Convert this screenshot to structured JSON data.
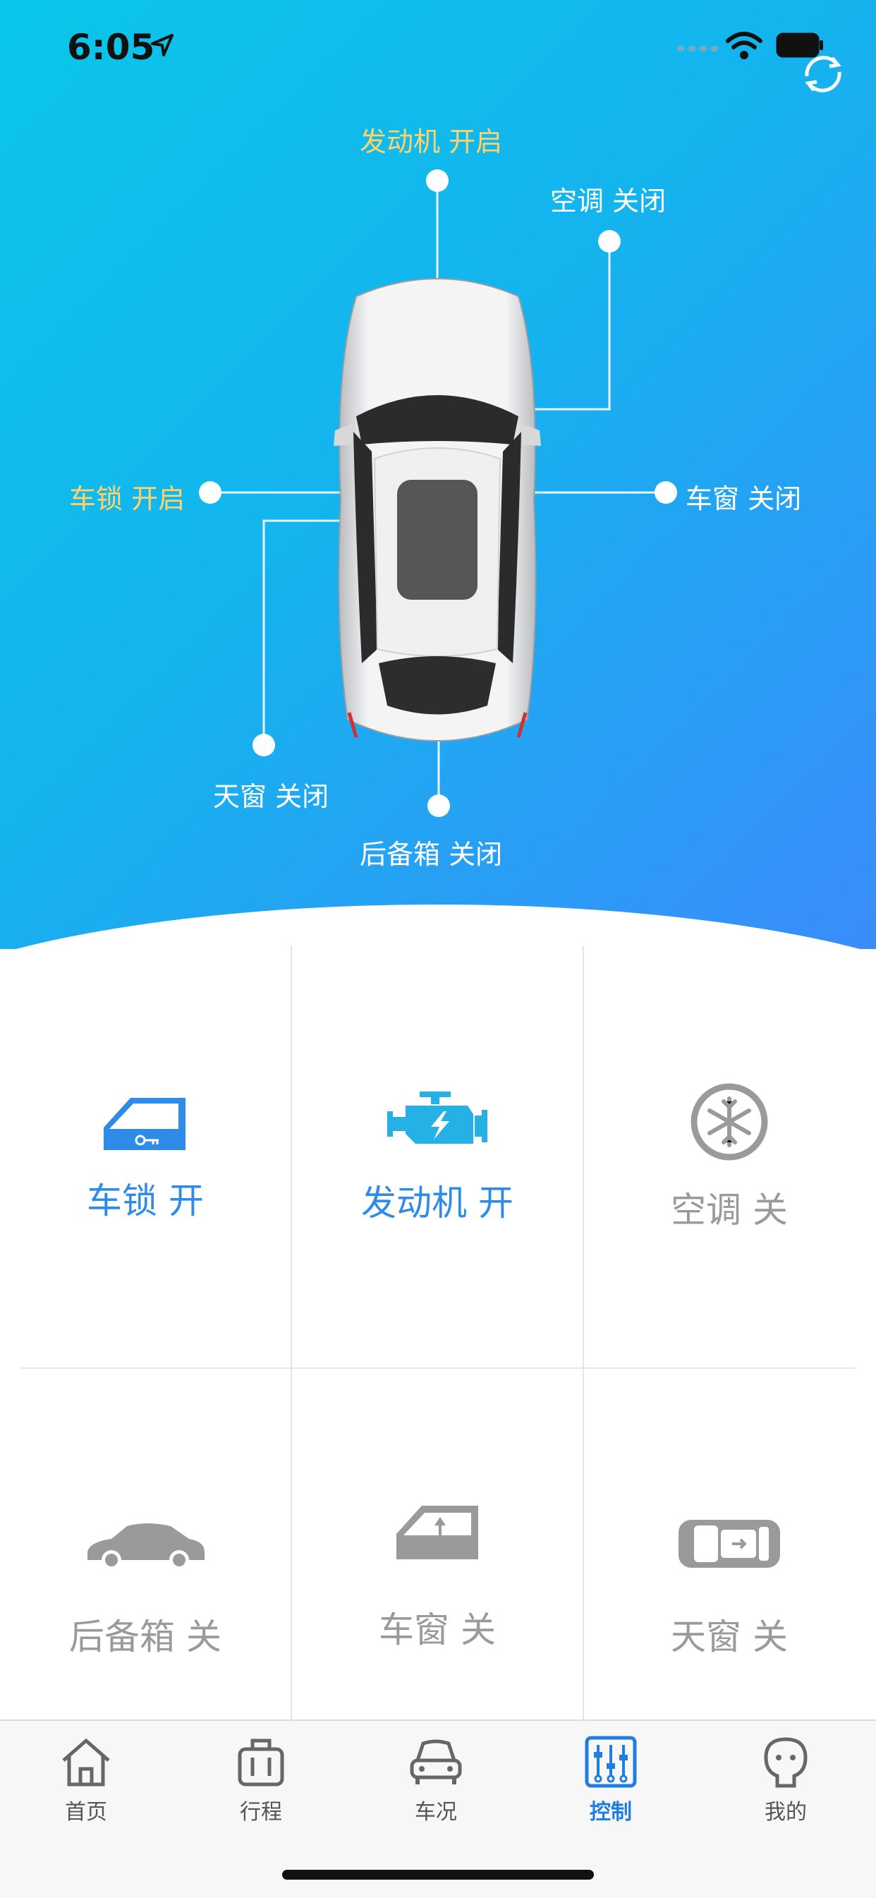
{
  "status": {
    "time": "6:05"
  },
  "car_status": {
    "engine": "发动机  开启",
    "ac": "空调  关闭",
    "lock": "车锁  开启",
    "window": "车窗  关闭",
    "sunroof": "天窗  关闭",
    "trunk": "后备箱  关闭"
  },
  "controls": [
    {
      "label": "车锁 开",
      "icon": "door-lock-icon",
      "state": "on"
    },
    {
      "label": "发动机 开",
      "icon": "engine-icon",
      "state": "on"
    },
    {
      "label": "空调 关",
      "icon": "snowflake-icon",
      "state": "off"
    },
    {
      "label": "后备箱 关",
      "icon": "car-side-icon",
      "state": "off"
    },
    {
      "label": "车窗 关",
      "icon": "car-window-icon",
      "state": "off"
    },
    {
      "label": "天窗 关",
      "icon": "sunroof-icon",
      "state": "off"
    }
  ],
  "tabs": [
    {
      "label": "首页",
      "icon": "home-icon"
    },
    {
      "label": "行程",
      "icon": "luggage-icon"
    },
    {
      "label": "车况",
      "icon": "car-front-icon"
    },
    {
      "label": "控制",
      "icon": "sliders-icon",
      "active": true
    },
    {
      "label": "我的",
      "icon": "user-icon"
    }
  ],
  "colors": {
    "accent": "#2f8be8",
    "active_label": "#ffd36a",
    "inactive": "#9a9a9a"
  }
}
